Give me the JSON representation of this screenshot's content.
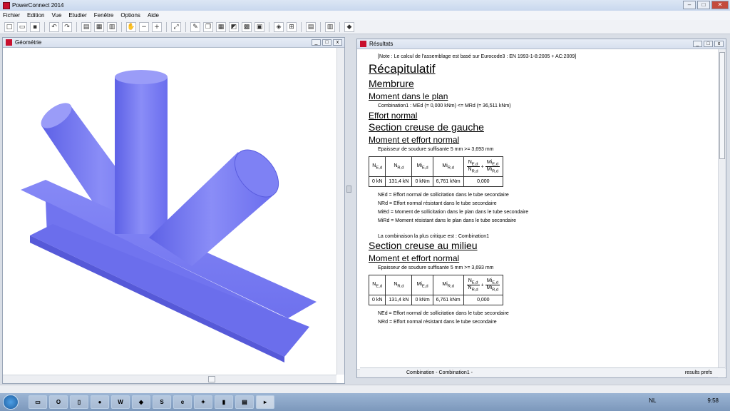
{
  "app": {
    "title": "PowerConnect 2014"
  },
  "menu": [
    "Fichier",
    "Edition",
    "Vue",
    "Etudier",
    "Fenêtre",
    "Options",
    "Aide"
  ],
  "toolbar_icons": [
    "new-icon",
    "open-icon",
    "save-icon",
    "undo-icon",
    "redo-icon",
    "preview-icon",
    "print-icon",
    "chart-icon",
    "pan-icon",
    "zoom-out-icon",
    "zoom-in-icon",
    "fit-icon",
    "pen-icon",
    "copy-icon",
    "table-icon",
    "graph-icon",
    "grid-icon",
    "layers-icon",
    "frame-icon",
    "calculator-icon",
    "report-icon",
    "book-icon"
  ],
  "geometry": {
    "title": "Géométrie",
    "color": "#7a7df4"
  },
  "results": {
    "title": "Résultats",
    "note": "[Note : Le calcul de l'assemblage est basé sur Eurocode3 : EN 1993-1-8:2005 + AC:2009]",
    "recap": "Récapitulatif",
    "membrure": "Membrure",
    "moment_plan": "Moment dans le plan",
    "combination_line": "Combination1 : MEd (= 0,000 kNm) <= MRd (= 36,511 kNm)",
    "effort_normal": "Effort normal",
    "section_gauche": "Section creuse de gauche",
    "moment_effort": "Moment et effort normal",
    "soudure": "Epaisseur de soudure suffisante 5 mm >= 3,693 mm",
    "headers": {
      "ned": "N",
      "ned_sub": "E,d",
      "nrd": "N",
      "nrd_sub": "R,d",
      "mied": "Mi",
      "mied_sub": "E,d",
      "mird": "Mi",
      "mird_sub": "R,d",
      "plus": "+"
    },
    "row1": [
      "0 kN",
      "131,4 kN",
      "0 kNm",
      "6,761 kNm",
      "0,000"
    ],
    "defs": [
      "NEd = Effort normal de sollicitation dans le tube secondaire",
      "NRd = Effort normal résistant dans le tube secondaire",
      "MiEd = Moment de sollicitation dans le plan dans le tube secondaire",
      "MiRd = Moment résistant dans le plan dans le tube secondaire"
    ],
    "critique": "La combinaison la plus critique est : Combination1",
    "section_milieu": "Section creuse au milieu",
    "moment_effort2": "Moment et effort normal",
    "soudure2": "Epaisseur de soudure suffisante 5 mm >= 3,693 mm",
    "row2": [
      "0 kN",
      "131,4 kN",
      "0 kNm",
      "6,761 kNm",
      "0,000"
    ],
    "def_last": "NEd = Effort normal de sollicitation dans le tube secondaire",
    "def_cut": "NRd = Effort normal résistant dans le tube secondaire"
  },
  "status": {
    "combination": "Combination - Combination1 -",
    "right": "results prefs"
  },
  "taskbar": {
    "lang": "NL",
    "time": "9:58"
  }
}
